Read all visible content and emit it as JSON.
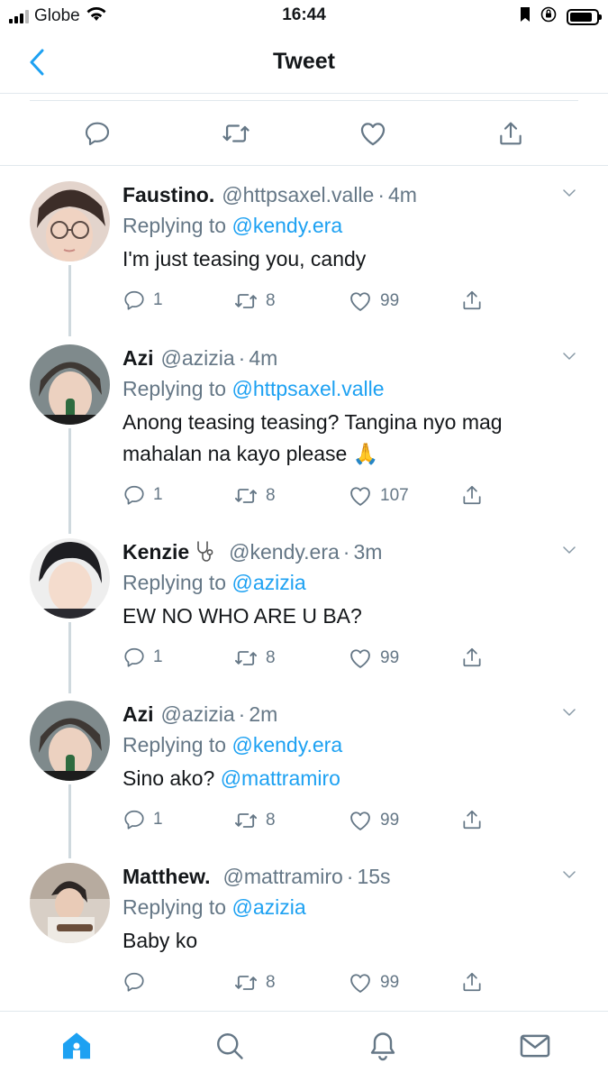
{
  "status_bar": {
    "carrier": "Globe",
    "time": "16:44",
    "battery_level": 0.85
  },
  "nav": {
    "title": "Tweet"
  },
  "colors": {
    "accent": "#1da1f2",
    "secondary_text": "#657786",
    "divider": "#e1e8ed"
  },
  "tweets": [
    {
      "display_name": "Faustino.",
      "handle": "@httpsaxel.valle",
      "time": "4m",
      "replying_prefix": "Replying to",
      "replying_to": "@kendy.era",
      "text": "I'm just teasing you, candy",
      "replies": "1",
      "retweets": "8",
      "likes": "99"
    },
    {
      "display_name": "Azi",
      "handle": "@azizia",
      "time": "4m",
      "replying_prefix": "Replying to",
      "replying_to": "@httpsaxel.valle",
      "text_line1": "Anong teasing teasing? Tangina nyo mag",
      "text_line2": "mahalan na kayo please",
      "emoji": "🙏",
      "replies": "1",
      "retweets": "8",
      "likes": "107"
    },
    {
      "display_name": "Kenzie",
      "name_icon": "stethoscope-icon",
      "handle": "@kendy.era",
      "time": "3m",
      "replying_prefix": "Replying to",
      "replying_to": "@azizia",
      "text": "EW NO WHO ARE U BA?",
      "replies": "1",
      "retweets": "8",
      "likes": "99"
    },
    {
      "display_name": "Azi",
      "handle": "@azizia",
      "time": "2m",
      "replying_prefix": "Replying to",
      "replying_to": "@kendy.era",
      "text_prefix": "Sino ako?",
      "text_mention": "@mattramiro",
      "replies": "1",
      "retweets": "8",
      "likes": "99"
    },
    {
      "display_name": "Matthew.",
      "handle": "@mattramiro",
      "time": "15s",
      "replying_prefix": "Replying to",
      "replying_to": "@azizia",
      "text": "Baby ko",
      "replies": "",
      "retweets": "8",
      "likes": "99"
    }
  ],
  "tab_bar": {
    "items": [
      "home-icon",
      "search-icon",
      "notifications-icon",
      "messages-icon"
    ],
    "active": "home-icon"
  }
}
